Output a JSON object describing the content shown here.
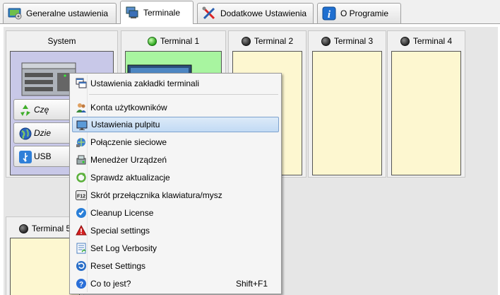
{
  "tabs": [
    {
      "label": "Generalne ustawienia",
      "icon": "settings-screen-icon"
    },
    {
      "label": "Terminale",
      "icon": "terminals-icon"
    },
    {
      "label": "Dodatkowe Ustawienia",
      "icon": "tools-icon"
    },
    {
      "label": "O Programie",
      "icon": "info-icon"
    }
  ],
  "active_tab": "Terminale",
  "system_card": {
    "title": "System",
    "buttons": [
      {
        "label": "Czę",
        "icon": "recycle-icon"
      },
      {
        "label": "Dzie",
        "icon": "globe-icon"
      },
      {
        "label": "USB",
        "icon": "usb-icon"
      }
    ]
  },
  "terminals": [
    {
      "label": "Terminal 1",
      "status": "on"
    },
    {
      "label": "Terminal 2",
      "status": "off"
    },
    {
      "label": "Terminal 3",
      "status": "off"
    },
    {
      "label": "Terminal 4",
      "status": "off"
    },
    {
      "label": "Terminal 5",
      "status": "off"
    }
  ],
  "context_menu": {
    "header": {
      "label": "Ustawienia zakładki terminali",
      "icon": "windows-icon"
    },
    "items": [
      {
        "label": "Konta użytkowników",
        "icon": "users-icon",
        "shortcut": ""
      },
      {
        "label": "Ustawienia pulpitu",
        "icon": "desktop-icon",
        "shortcut": "",
        "highlighted": true
      },
      {
        "label": "Połączenie sieciowe",
        "icon": "network-icon",
        "shortcut": ""
      },
      {
        "label": "Menedżer Urządzeń",
        "icon": "device-manager-icon",
        "shortcut": ""
      },
      {
        "label": "Sprawdz aktualizacje",
        "icon": "update-icon",
        "shortcut": ""
      },
      {
        "label": "Skrót przełącznika klawiatura/mysz",
        "icon": "f12-key-icon",
        "shortcut": ""
      },
      {
        "label": "Cleanup License",
        "icon": "cleanup-icon",
        "shortcut": ""
      },
      {
        "label": "Special settings",
        "icon": "warning-icon",
        "shortcut": ""
      },
      {
        "label": "Set Log Verbosity",
        "icon": "log-icon",
        "shortcut": ""
      },
      {
        "label": "Reset Settings",
        "icon": "reset-icon",
        "shortcut": ""
      },
      {
        "label": "Co to jest?",
        "icon": "help-icon",
        "shortcut": "Shift+F1"
      }
    ]
  },
  "colors": {
    "terminal_active_bg": "#a8f5a0",
    "terminal_idle_bg": "#fdf7d0",
    "system_bg": "#c8c8e8",
    "menu_highlight": "#c2daf4"
  }
}
